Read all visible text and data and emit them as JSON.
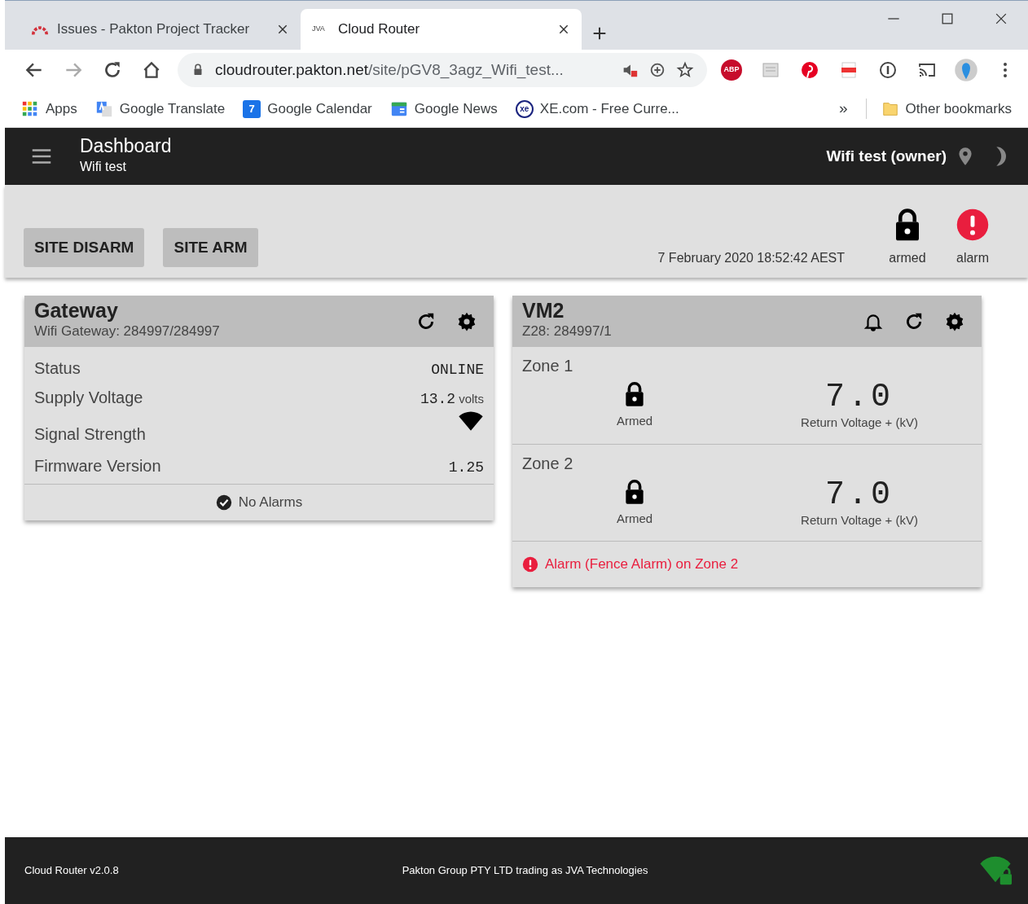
{
  "browser": {
    "tabs": [
      {
        "title": "Issues - Pakton Project Tracker",
        "kind": "arc",
        "selected": false
      },
      {
        "title": "Cloud Router",
        "kind": "text",
        "icon_text": "JVA",
        "selected": true
      }
    ],
    "address": {
      "host": "cloudrouter.pakton.net",
      "path": "/site/pGV8_3agz_Wifi_test..."
    },
    "extensions": [
      {
        "kind": "abp",
        "text": "ABP"
      },
      {
        "kind": "page"
      },
      {
        "kind": "pin"
      },
      {
        "kind": "pdf"
      },
      {
        "kind": "info"
      }
    ],
    "bookmarks": [
      {
        "label": "Apps",
        "kind": "grid"
      },
      {
        "label": "Google Translate",
        "kind": "translate"
      },
      {
        "label": "Google Calendar",
        "kind": "calendar",
        "icon_text": "7"
      },
      {
        "label": "Google News",
        "kind": "news"
      },
      {
        "label": "XE.com - Free Curre...",
        "kind": "xe",
        "icon_text": "xe"
      }
    ],
    "overflow": "»",
    "other_bookmarks": "Other bookmarks"
  },
  "app_bar": {
    "title": "Dashboard",
    "subtitle": "Wifi test",
    "user": "Wifi test (owner)"
  },
  "toolbar": {
    "buttons": [
      "SITE DISARM",
      "SITE ARM"
    ],
    "timestamp": "7 February 2020 18:52:42 AEST",
    "status": [
      {
        "kind": "lock",
        "label": "armed"
      },
      {
        "kind": "alert",
        "label": "alarm"
      }
    ]
  },
  "cards": [
    {
      "kind": "gateway",
      "title": "Gateway",
      "subtitle": "Wifi Gateway: 284997/284997",
      "actions": [
        {
          "kind": "refresh"
        },
        {
          "kind": "settings"
        }
      ],
      "rows": [
        {
          "kind": "text",
          "label": "Status",
          "value": "ONLINE"
        },
        {
          "kind": "text",
          "label": "Supply Voltage",
          "value": "13.2",
          "unit": "volts"
        },
        {
          "kind": "signal",
          "label": "Signal Strength"
        },
        {
          "kind": "text",
          "label": "Firmware Version",
          "value": "1.25"
        }
      ],
      "footer": {
        "kind": "ok",
        "text": "No Alarms"
      }
    },
    {
      "kind": "zones",
      "title": "VM2",
      "subtitle": "Z28: 284997/1",
      "actions": [
        {
          "kind": "bell"
        },
        {
          "kind": "refresh"
        },
        {
          "kind": "settings"
        }
      ],
      "zones": [
        {
          "name": "Zone 1",
          "state": "Armed",
          "reading": "7.0",
          "reading_label": "Return Voltage + (kV)"
        },
        {
          "name": "Zone 2",
          "state": "Armed",
          "reading": "7.0",
          "reading_label": "Return Voltage + (kV)"
        }
      ],
      "footer": {
        "kind": "alarm",
        "text": "Alarm (Fence Alarm) on Zone 2"
      }
    }
  ],
  "footer": {
    "version": "Cloud Router v2.0.8",
    "company": "Pakton Group PTY LTD trading as JVA Technologies"
  }
}
